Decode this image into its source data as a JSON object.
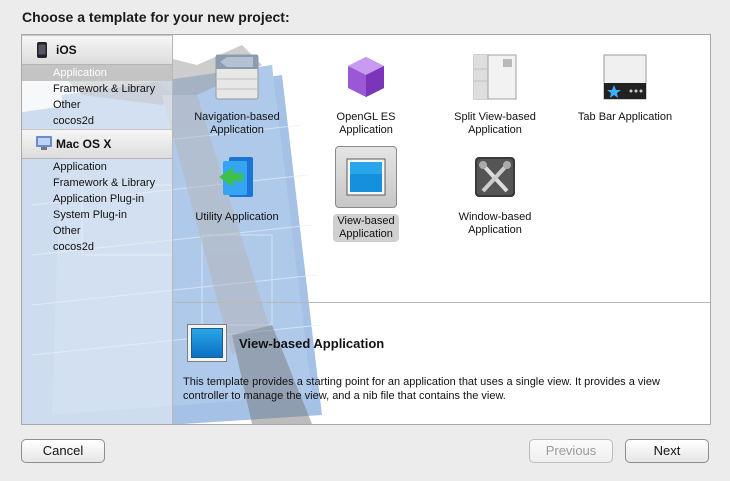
{
  "window": {
    "title": "Choose a template for your new project:"
  },
  "sidebar": {
    "groups": [
      {
        "label": "iOS",
        "icon": "iphone-icon",
        "items": [
          "Application",
          "Framework & Library",
          "Other",
          "cocos2d"
        ],
        "selected": 0
      },
      {
        "label": "Mac OS X",
        "icon": "mac-icon",
        "items": [
          "Application",
          "Framework & Library",
          "Application Plug-in",
          "System Plug-in",
          "Other",
          "cocos2d"
        ]
      }
    ]
  },
  "templates": [
    {
      "label": "Navigation-based Application",
      "l1": "Navigation-based",
      "l2": "Application",
      "icon": "navigation-app-icon"
    },
    {
      "label": "OpenGL ES Application",
      "l1": "OpenGL ES",
      "l2": "Application",
      "icon": "opengl-cube-icon"
    },
    {
      "label": "Split View-based Application",
      "l1": "Split View-based",
      "l2": "Application",
      "icon": "split-view-icon"
    },
    {
      "label": "Tab Bar Application",
      "l1": "Tab Bar Application",
      "l2": "",
      "icon": "tab-bar-icon"
    },
    {
      "label": "Utility Application",
      "l1": "Utility Application",
      "l2": "",
      "icon": "utility-app-icon"
    },
    {
      "label": "View-based Application",
      "l1": "View-based",
      "l2": "Application",
      "icon": "view-based-icon",
      "selected": true
    },
    {
      "label": "Window-based Application",
      "l1": "Window-based",
      "l2": "Application",
      "icon": "window-tools-icon"
    }
  ],
  "description": {
    "title": "View-based Application",
    "text": "This template provides a starting point for an application that uses a single view. It provides a view controller to manage the view, and a nib file that contains the view."
  },
  "buttons": {
    "cancel": "Cancel",
    "previous": "Previous",
    "next": "Next"
  },
  "colors": {
    "accent_blue": "#0a7fd1",
    "selection_gray": "#c4c4c4"
  }
}
